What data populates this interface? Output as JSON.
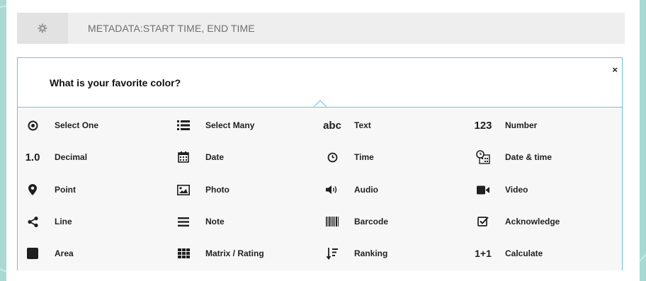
{
  "metadata_bar": {
    "label": "METADATA:START TIME, END TIME",
    "icon": "gear-icon"
  },
  "chooser": {
    "question": "What is your favorite color?",
    "close_label": "×",
    "types": [
      {
        "label": "Select One",
        "icon": "radio-icon"
      },
      {
        "label": "Select Many",
        "icon": "list-icon"
      },
      {
        "label": "Text",
        "icon": "text-icon",
        "glyph": "abc"
      },
      {
        "label": "Number",
        "icon": "number-icon",
        "glyph": "123"
      },
      {
        "label": "Decimal",
        "icon": "decimal-icon",
        "glyph": "1.0"
      },
      {
        "label": "Date",
        "icon": "calendar-icon"
      },
      {
        "label": "Time",
        "icon": "clock-icon"
      },
      {
        "label": "Date & time",
        "icon": "calendar-clock-icon"
      },
      {
        "label": "Point",
        "icon": "map-marker-icon"
      },
      {
        "label": "Photo",
        "icon": "image-icon"
      },
      {
        "label": "Audio",
        "icon": "volume-icon"
      },
      {
        "label": "Video",
        "icon": "video-camera-icon"
      },
      {
        "label": "Line",
        "icon": "share-line-icon"
      },
      {
        "label": "Note",
        "icon": "note-lines-icon"
      },
      {
        "label": "Barcode",
        "icon": "barcode-icon"
      },
      {
        "label": "Acknowledge",
        "icon": "checkbox-icon"
      },
      {
        "label": "Area",
        "icon": "square-icon"
      },
      {
        "label": "Matrix / Rating",
        "icon": "grid-icon"
      },
      {
        "label": "Ranking",
        "icon": "sort-icon"
      },
      {
        "label": "Calculate",
        "icon": "calculate-icon",
        "glyph": "1+1"
      }
    ]
  },
  "colors": {
    "accent": "#6ec1d1",
    "background": "#a9d9d3",
    "metadata_bg": "#eeeeee"
  }
}
